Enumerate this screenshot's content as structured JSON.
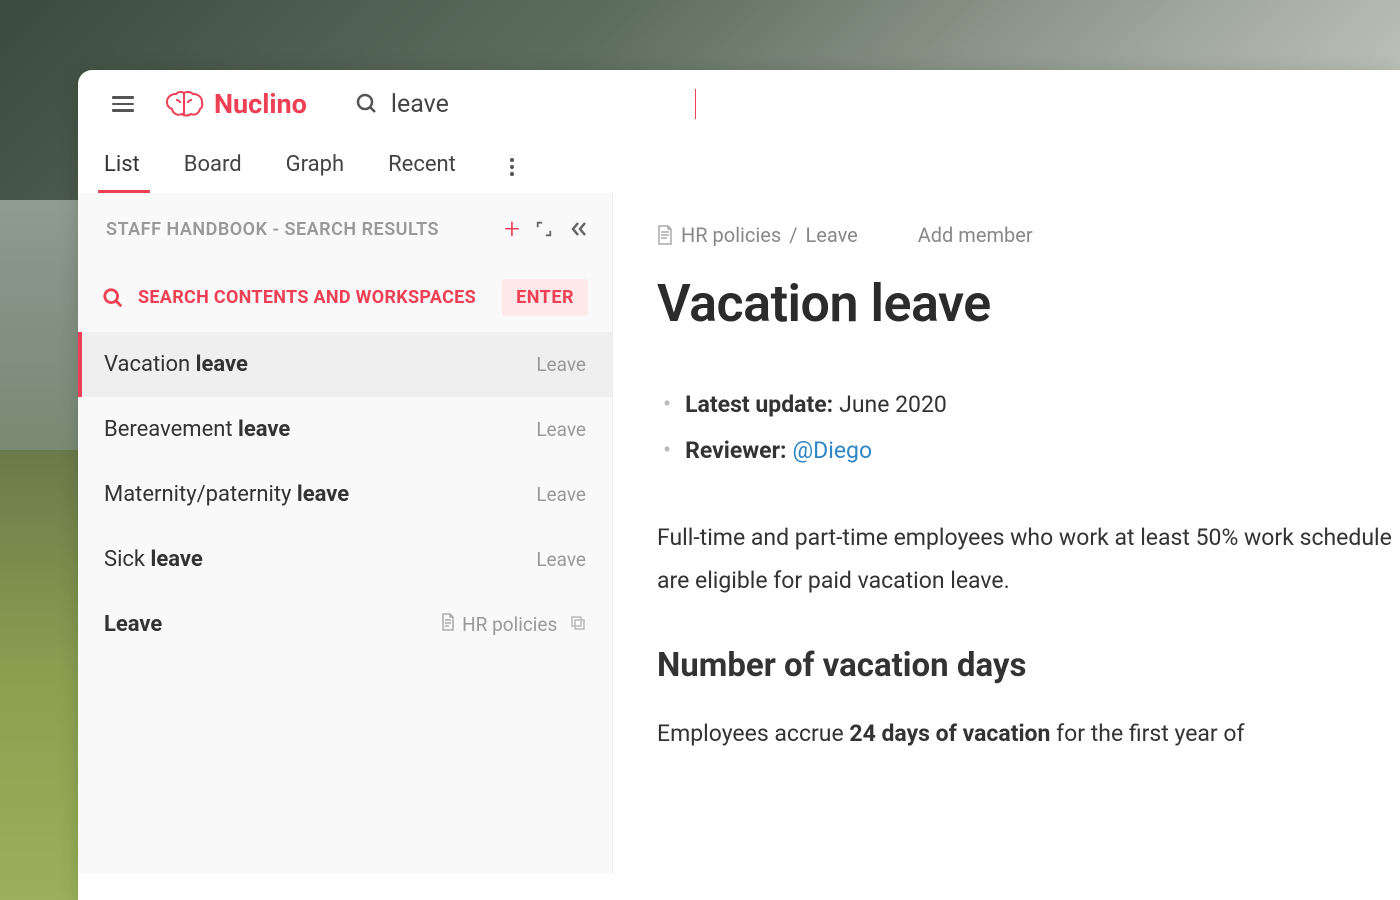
{
  "brand": {
    "name": "Nuclino"
  },
  "search": {
    "value": "leave"
  },
  "tabs": [
    "List",
    "Board",
    "Graph",
    "Recent"
  ],
  "active_tab": 0,
  "sidebar": {
    "header_label": "STAFF HANDBOOK - SEARCH RESULTS",
    "search_action_label": "SEARCH CONTENTS AND WORKSPACES",
    "enter_badge": "ENTER",
    "results": [
      {
        "prefix": "Vacation ",
        "match": "leave",
        "category": "Leave",
        "selected": true
      },
      {
        "prefix": "Bereavement ",
        "match": "leave",
        "category": "Leave",
        "selected": false
      },
      {
        "prefix": "Maternity/paternity ",
        "match": "leave",
        "category": "Leave",
        "selected": false
      },
      {
        "prefix": "Sick ",
        "match": "leave",
        "category": "Leave",
        "selected": false
      },
      {
        "prefix": "",
        "match": "Leave",
        "category": "HR policies",
        "selected": false,
        "has_doc_icon": true,
        "has_copy_icon": true
      }
    ]
  },
  "document": {
    "breadcrumb": [
      "HR policies",
      "Leave"
    ],
    "add_member_label": "Add member",
    "title": "Vacation leave",
    "meta": {
      "update_key": "Latest update:",
      "update_value": "June 2020",
      "reviewer_key": "Reviewer:",
      "reviewer_value": "@Diego"
    },
    "paragraph1": "Full-time and part-time employees who work at least 50% work schedule are eligible for paid vacation leave.",
    "h2": "Number of vacation days",
    "p2_pre": "Employees accrue ",
    "p2_bold": "24 days of vacation",
    "p2_post": " for the first year of"
  }
}
